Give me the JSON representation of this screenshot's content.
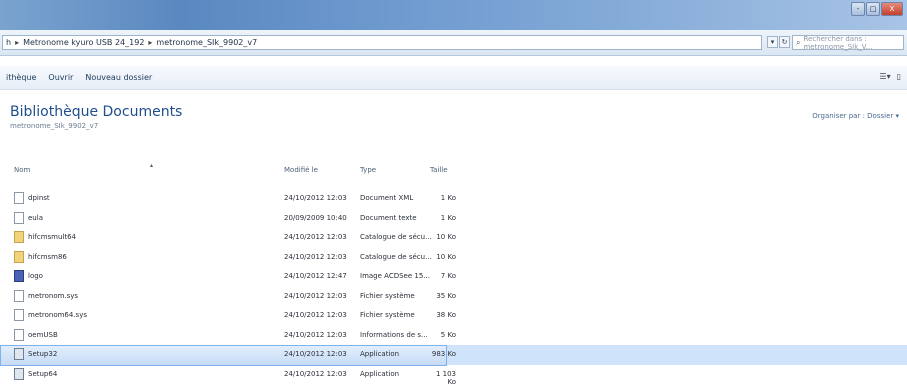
{
  "window": {
    "controls": [
      "-",
      "□",
      "X"
    ]
  },
  "address": {
    "crumbs": [
      "h",
      "Metronome kyuro USB 24_192",
      "metronome_SIk_9902_v7"
    ],
    "separator": "▸",
    "search_placeholder": "Rechercher dans : metronome_SIk_V..."
  },
  "toolbar": {
    "items": [
      "ithèque",
      "Ouvrir",
      "Nouveau dossier"
    ],
    "right_icons": [
      "view-icon",
      "preview-pane-icon"
    ]
  },
  "library": {
    "title": "Bibliothèque Documents",
    "path": "metronome_SIk_9902_v7",
    "arrange": "Organiser par :  Dossier ▾"
  },
  "columns": {
    "name": "Nom",
    "date": "Modifié le",
    "type": "Type",
    "size": "Taille"
  },
  "files": [
    {
      "icon": "document-icon",
      "name": "dpinst",
      "date": "24/10/2012 12:03",
      "type": "Document XML",
      "size": "1 Ko"
    },
    {
      "icon": "text-file-icon",
      "name": "eula",
      "date": "20/09/2009 10:40",
      "type": "Document texte",
      "size": "1 Ko"
    },
    {
      "icon": "catalog-icon",
      "name": "hifcmsmult64",
      "date": "24/10/2012 12:03",
      "type": "Catalogue de sécu...",
      "size": "10 Ko"
    },
    {
      "icon": "catalog-icon",
      "name": "hifcmsm86",
      "date": "24/10/2012 12:03",
      "type": "Catalogue de sécu...",
      "size": "10 Ko"
    },
    {
      "icon": "image-icon",
      "name": "logo",
      "date": "24/10/2012 12:47",
      "type": "Image ACDSee 15...",
      "size": "7 Ko"
    },
    {
      "icon": "system-file-icon",
      "name": "metronom.sys",
      "date": "24/10/2012 12:03",
      "type": "Fichier système",
      "size": "35 Ko"
    },
    {
      "icon": "system-file-icon",
      "name": "metronom64.sys",
      "date": "24/10/2012 12:03",
      "type": "Fichier système",
      "size": "38 Ko"
    },
    {
      "icon": "setup-info-icon",
      "name": "oemUSB",
      "date": "24/10/2012 12:03",
      "type": "Informations de s...",
      "size": "5 Ko"
    },
    {
      "icon": "application-icon",
      "name": "Setup32",
      "date": "24/10/2012 12:03",
      "type": "Application",
      "size": "983 Ko",
      "selected": true
    },
    {
      "icon": "application-icon",
      "name": "Setup64",
      "date": "24/10/2012 12:03",
      "type": "Application",
      "size": "1 103 Ko"
    }
  ]
}
